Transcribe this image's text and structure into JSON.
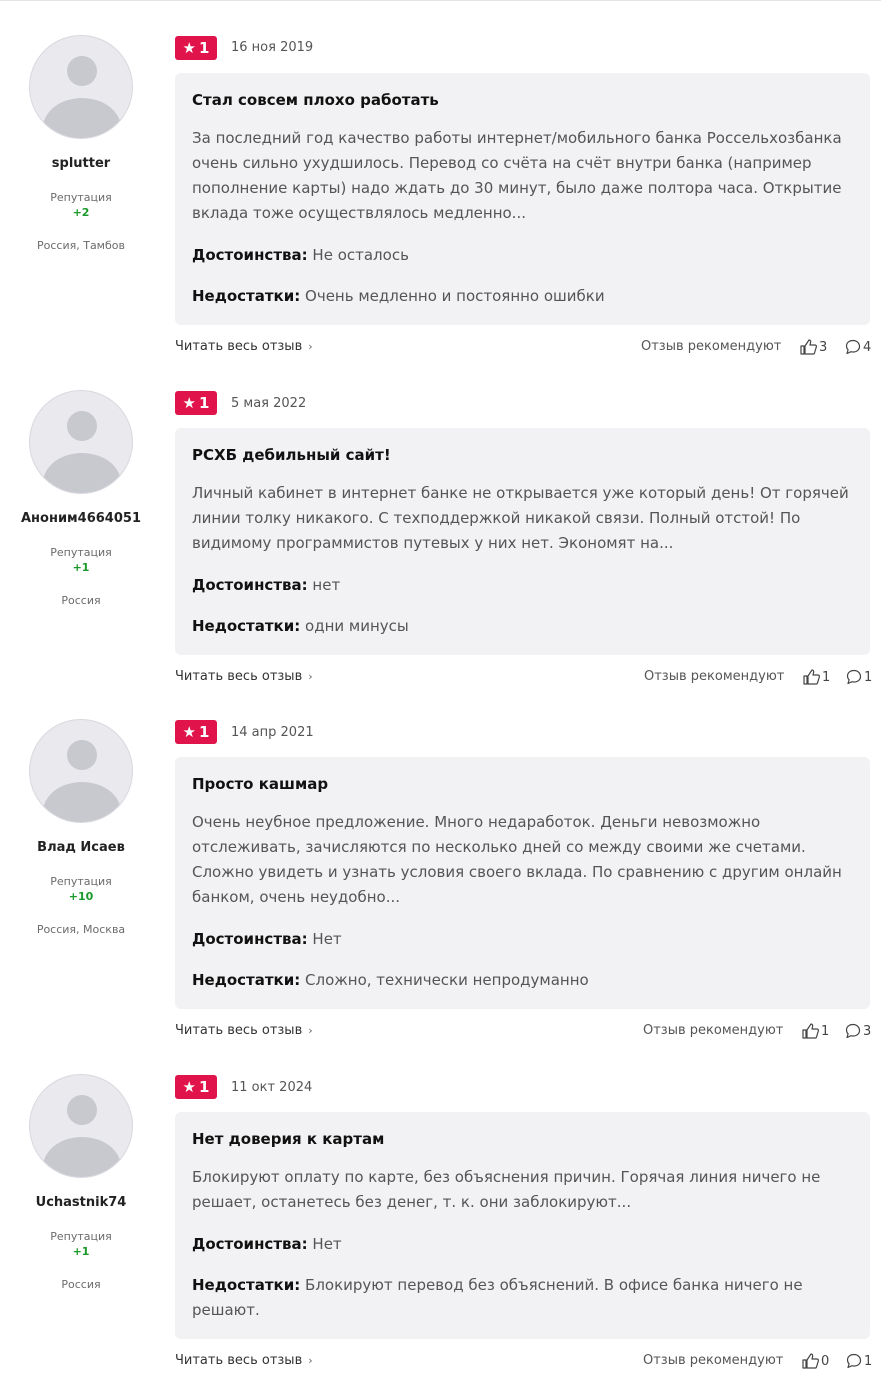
{
  "reviews": [
    {
      "username": "splutter",
      "rep_label": "Репутация",
      "rep_value": "+2",
      "location": "Россия, Тамбов",
      "rating": "1",
      "date": "16 ноя 2019",
      "title": "Стал совсем плохо работать",
      "text": "За последний год качество работы интернет/мобильного банка Россельхозбанка очень сильно ухудшилось. Перевод со счёта на счёт внутри банка (например пополнение карты) надо ждать до 30 минут, было даже полтора часа. Открытие вклада тоже осуществлялось медленно...",
      "pros_label": "Достоинства:",
      "pros": "Не осталось",
      "cons_label": "Недостатки:",
      "cons": "Очень медленно и постоянно ошибки",
      "read_more": "Читать весь отзыв",
      "recommend": "Отзыв рекомендуют",
      "likes": "3",
      "comments": "4"
    },
    {
      "username": "Аноним4664051",
      "rep_label": "Репутация",
      "rep_value": "+1",
      "location": "Россия",
      "rating": "1",
      "date": "5 мая 2022",
      "title": "РСХБ дебильный сайт!",
      "text": "Личный кабинет в интернет банке не открывается уже который день! От горячей линии толку никакого. С техподдержкой никакой связи. Полный отстой! По видимому программистов путевых у них нет. Экономят на...",
      "pros_label": "Достоинства:",
      "pros": "нет",
      "cons_label": "Недостатки:",
      "cons": "одни минусы",
      "read_more": "Читать весь отзыв",
      "recommend": "Отзыв рекомендуют",
      "likes": "1",
      "comments": "1"
    },
    {
      "username": "Влад Исаев",
      "rep_label": "Репутация",
      "rep_value": "+10",
      "location": "Россия, Москва",
      "rating": "1",
      "date": "14 апр 2021",
      "title": "Просто кашмар",
      "text": "Очень неубное предложение. Много недаработок. Деньги невозможно отслеживать, зачисляются по несколько дней со между своими же счетами. Сложно увидеть и узнать условия своего вклада. По сравнению с другим онлайн банком, очень неудобно...",
      "pros_label": "Достоинства:",
      "pros": "Нет",
      "cons_label": "Недостатки:",
      "cons": "Сложно, технически непродуманно",
      "read_more": "Читать весь отзыв",
      "recommend": "Отзыв рекомендуют",
      "likes": "1",
      "comments": "3"
    },
    {
      "username": "Uchastnik74",
      "rep_label": "Репутация",
      "rep_value": "+1",
      "location": "Россия",
      "rating": "1",
      "date": "11 окт 2024",
      "title": "Нет доверия к картам",
      "text": "Блокируют оплату по карте, без объяснения причин. Горячая линия ничего не решает, останетесь без денег, т. к. они заблокируют...",
      "pros_label": "Достоинства:",
      "pros": "Нет",
      "cons_label": "Недостатки:",
      "cons": "Блокируют перевод без объяснений. В офисе банка ничего не решают.",
      "read_more": "Читать весь отзыв",
      "recommend": "Отзыв рекомендуют",
      "likes": "0",
      "comments": "1"
    }
  ]
}
